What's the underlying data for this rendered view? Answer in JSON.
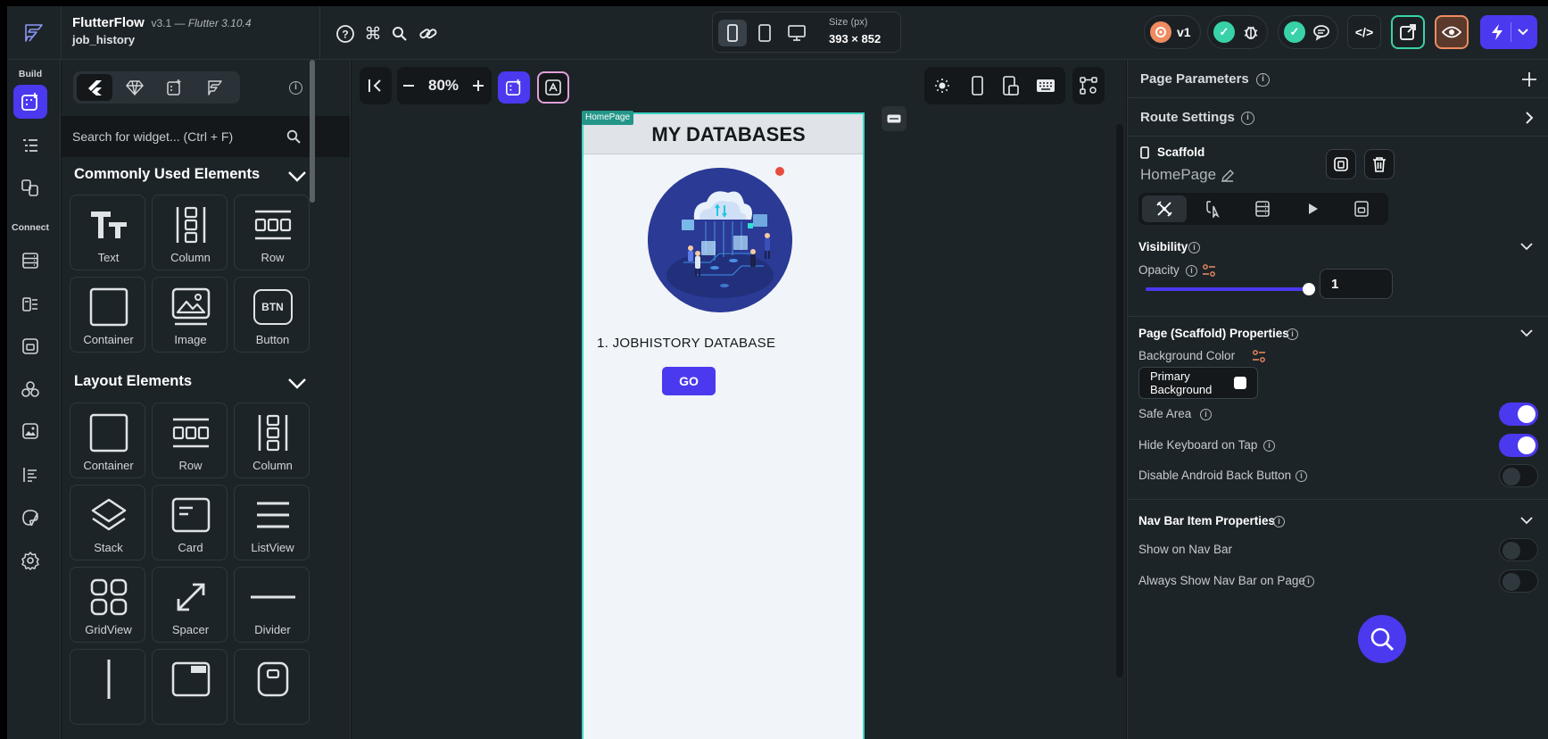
{
  "topbar": {
    "app_name": "FlutterFlow",
    "version": "v3.1 —",
    "flutter_version": "Flutter 3.10.4",
    "project_name": "job_history",
    "size_label": "Size (px)",
    "size_value": "393 × 852",
    "version_badge": "v1",
    "code_label": "</>",
    "icons": [
      "help-icon",
      "command-icon",
      "search-icon",
      "link-icon",
      "phone-icon",
      "tablet-icon",
      "desktop-icon",
      "debug-icon",
      "comment-icon",
      "open-external-icon",
      "preview-eye-icon",
      "lightning-icon",
      "chevron-down-icon"
    ]
  },
  "rail": {
    "build_label": "Build",
    "connect_label": "Connect",
    "icons": [
      "widget-add-icon",
      "widget-tree-icon",
      "page-selector-icon",
      "firestore-icon",
      "api-calls-icon",
      "storage-icon",
      "integrations-icon",
      "media-assets-icon",
      "custom-code-icon",
      "theme-icon",
      "settings-icon"
    ]
  },
  "widgets": {
    "search_placeholder": "Search for widget... (Ctrl + F)",
    "common_title": "Commonly Used Elements",
    "common": [
      {
        "label": "Text",
        "icon": "text-icon"
      },
      {
        "label": "Column",
        "icon": "column-icon"
      },
      {
        "label": "Row",
        "icon": "row-icon"
      },
      {
        "label": "Container",
        "icon": "container-icon"
      },
      {
        "label": "Image",
        "icon": "image-icon"
      },
      {
        "label": "Button",
        "icon": "button-icon",
        "glyph": "BTN"
      }
    ],
    "layout_title": "Layout Elements",
    "layout": [
      {
        "label": "Container",
        "icon": "container-icon"
      },
      {
        "label": "Row",
        "icon": "row-icon"
      },
      {
        "label": "Column",
        "icon": "column-icon"
      },
      {
        "label": "Stack",
        "icon": "stack-icon"
      },
      {
        "label": "Card",
        "icon": "card-icon"
      },
      {
        "label": "ListView",
        "icon": "listview-icon"
      },
      {
        "label": "GridView",
        "icon": "gridview-icon"
      },
      {
        "label": "Spacer",
        "icon": "spacer-icon"
      },
      {
        "label": "Divider",
        "icon": "divider-icon"
      }
    ]
  },
  "canvas": {
    "zoom": "80%",
    "page_tag": "HomePage",
    "appbar_title": "MY DATABASES",
    "list_item": "1. JOBHISTORY DATABASE",
    "go_button": "GO"
  },
  "properties": {
    "page_parameters": "Page Parameters",
    "route_settings": "Route Settings",
    "widget_type": "Scaffold",
    "page_name": "HomePage",
    "visibility_title": "Visibility",
    "opacity_label": "Opacity",
    "opacity_value": "1",
    "opacity_fraction": 1.0,
    "scaffold_title": "Page (Scaffold) Properties",
    "background_color_label": "Background Color",
    "background_color_value_line1": "Primary",
    "background_color_value_line2": "Background",
    "safe_area_label": "Safe Area",
    "safe_area": true,
    "hide_keyboard_label": "Hide Keyboard on Tap",
    "hide_keyboard": true,
    "disable_back_label": "Disable Android Back Button",
    "disable_back": false,
    "navbar_title": "Nav Bar Item Properties",
    "show_navbar_label": "Show on Nav Bar",
    "show_navbar": false,
    "always_show_navbar_label": "Always Show Nav Bar on Page",
    "always_show_navbar": false
  },
  "colors": {
    "accent": "#4b39ef",
    "bg_dark": "#14181b",
    "panel": "#1d2428",
    "teal": "#3bd6c6",
    "check_green": "#39d2a8",
    "version_orange": "#ee8b60"
  }
}
